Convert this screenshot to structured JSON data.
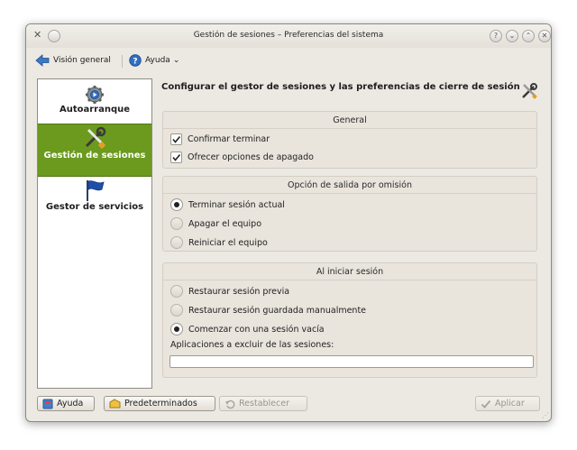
{
  "window": {
    "title": "Gestión de sesiones – Preferencias del sistema",
    "help_btn": "?",
    "min_btn": "⌄",
    "max_btn": "⌃",
    "close_btn": "✕"
  },
  "toolbar": {
    "back_label": "Visión general",
    "help_label": "Ayuda",
    "help_menu_arrow": "⌄"
  },
  "sidebar": {
    "items": [
      {
        "label": "Autoarranque",
        "icon": "gear-icon",
        "selected": false
      },
      {
        "label": "Gestión de sesiones",
        "icon": "tools-icon",
        "selected": true
      },
      {
        "label": "Gestor de servicios",
        "icon": "flag-icon",
        "selected": false
      }
    ]
  },
  "main": {
    "heading": "Configurar el gestor de sesiones y las preferencias de cierre de sesión",
    "general": {
      "title": "General",
      "confirm_logout": {
        "label": "Confirmar terminar",
        "checked": true
      },
      "offer_shutdown": {
        "label": "Ofrecer opciones de apagado",
        "checked": true
      }
    },
    "default_leave": {
      "title": "Opción de salida por omisión",
      "options": [
        {
          "label": "Terminar sesión actual",
          "selected": true
        },
        {
          "label": "Apagar el equipo",
          "selected": false
        },
        {
          "label": "Reiniciar el equipo",
          "selected": false
        }
      ]
    },
    "login": {
      "title": "Al iniciar sesión",
      "options": [
        {
          "label": "Restaurar sesión previa",
          "selected": false
        },
        {
          "label": "Restaurar sesión guardada manualmente",
          "selected": false
        },
        {
          "label": "Comenzar con una sesión vacía",
          "selected": true
        }
      ],
      "exclude_label": "Aplicaciones a excluir de las sesiones:",
      "exclude_value": ""
    }
  },
  "buttons": {
    "help": "Ayuda",
    "defaults": "Predeterminados",
    "reset": "Restablecer",
    "apply": "Aplicar"
  },
  "colors": {
    "selection": "#6b9a1e",
    "window_bg": "#ece8e2",
    "group_bg": "#e9e4dc"
  }
}
